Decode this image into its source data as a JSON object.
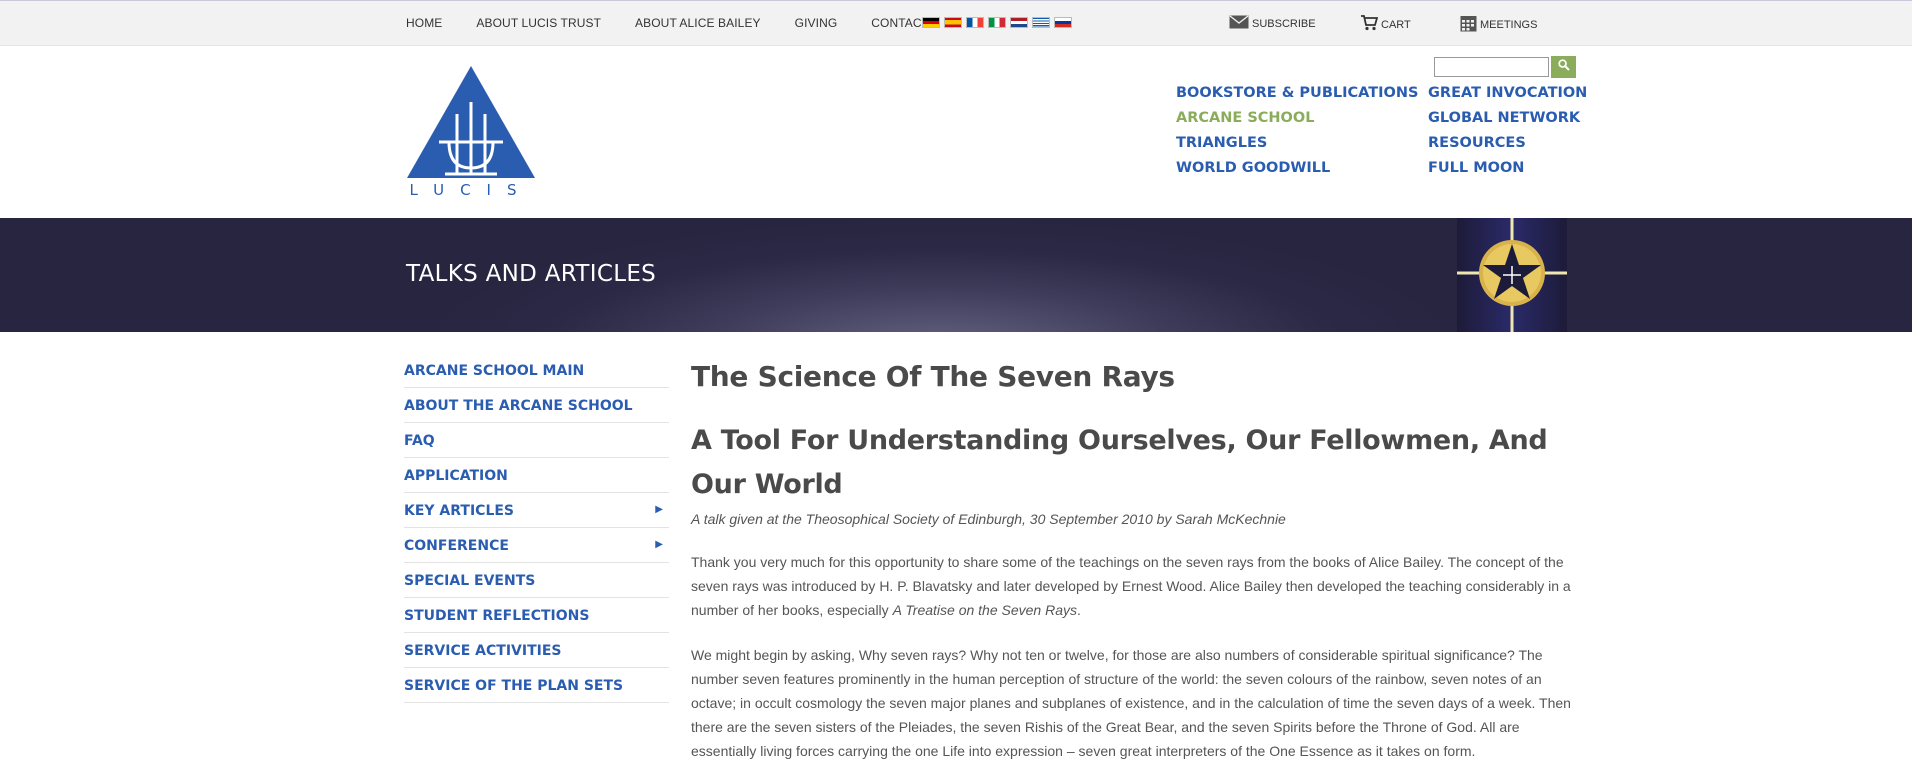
{
  "topbar": {
    "links": [
      "HOME",
      "ABOUT LUCIS TRUST",
      "ABOUT ALICE BAILEY",
      "GIVING",
      "CONTACT"
    ],
    "subscribe": "SUBSCRIBE",
    "cart": "CART",
    "meetings": "MEETINGS"
  },
  "logo": {
    "text": "LUCIS"
  },
  "mainnav": {
    "col1": [
      "BOOKSTORE & PUBLICATIONS",
      "ARCANE SCHOOL",
      "TRIANGLES",
      "WORLD GOODWILL"
    ],
    "col2": [
      "GREAT INVOCATION",
      "GLOBAL NETWORK",
      "RESOURCES",
      "FULL MOON"
    ]
  },
  "banner": {
    "title": "TALKS AND ARTICLES"
  },
  "sidebar": {
    "items": [
      {
        "label": "ARCANE SCHOOL MAIN"
      },
      {
        "label": "ABOUT THE ARCANE SCHOOL"
      },
      {
        "label": "FAQ"
      },
      {
        "label": "APPLICATION"
      },
      {
        "label": "KEY ARTICLES"
      },
      {
        "label": "CONFERENCE"
      },
      {
        "label": "SPECIAL EVENTS"
      },
      {
        "label": "STUDENT REFLECTIONS"
      },
      {
        "label": "SERVICE ACTIVITIES"
      },
      {
        "label": "SERVICE OF THE PLAN SETS"
      }
    ]
  },
  "article": {
    "title": "The Science Of The Seven Rays",
    "subtitle": "A Tool For Understanding Ourselves, Our Fellowmen, And Our World",
    "byline": "A talk given at the Theosophical Society of Edinburgh, 30 September 2010 by Sarah McKechnie",
    "p1_start": "Thank you very much for this opportunity to share some of the teachings on the seven rays from the books of Alice Bailey. The concept of the seven rays was introduced by H. P. Blavatsky and later developed by Ernest Wood. Alice Bailey then developed the teaching considerably in a number of her books, especially ",
    "p1_book": "A Treatise on the Seven Rays",
    "p1_end": ".",
    "p2": "We might begin by asking, Why seven rays? Why not ten or twelve, for those are also numbers of considerable spiritual significance? The number seven features prominently in the human perception of structure of the world: the seven colours of the rainbow, seven notes of an octave; in occult cosmology the seven major planes and subplanes of existence, and in the calculation of time the seven days of a week. Then there are the seven sisters of the Pleiades, the seven Rishis of the Great Bear, and the seven Spirits before the Throne of God. All are essentially living forces carrying the one Life into expression – seven great interpreters of the One Essence as it takes on form."
  },
  "colors": {
    "brand_blue": "#2a5db0",
    "accent_green": "#8aac5b",
    "banner_dark": "#2b2946"
  },
  "icons": [
    "mail-icon",
    "cart-icon",
    "calendar-icon",
    "search-icon",
    "chevron-right-icon"
  ]
}
